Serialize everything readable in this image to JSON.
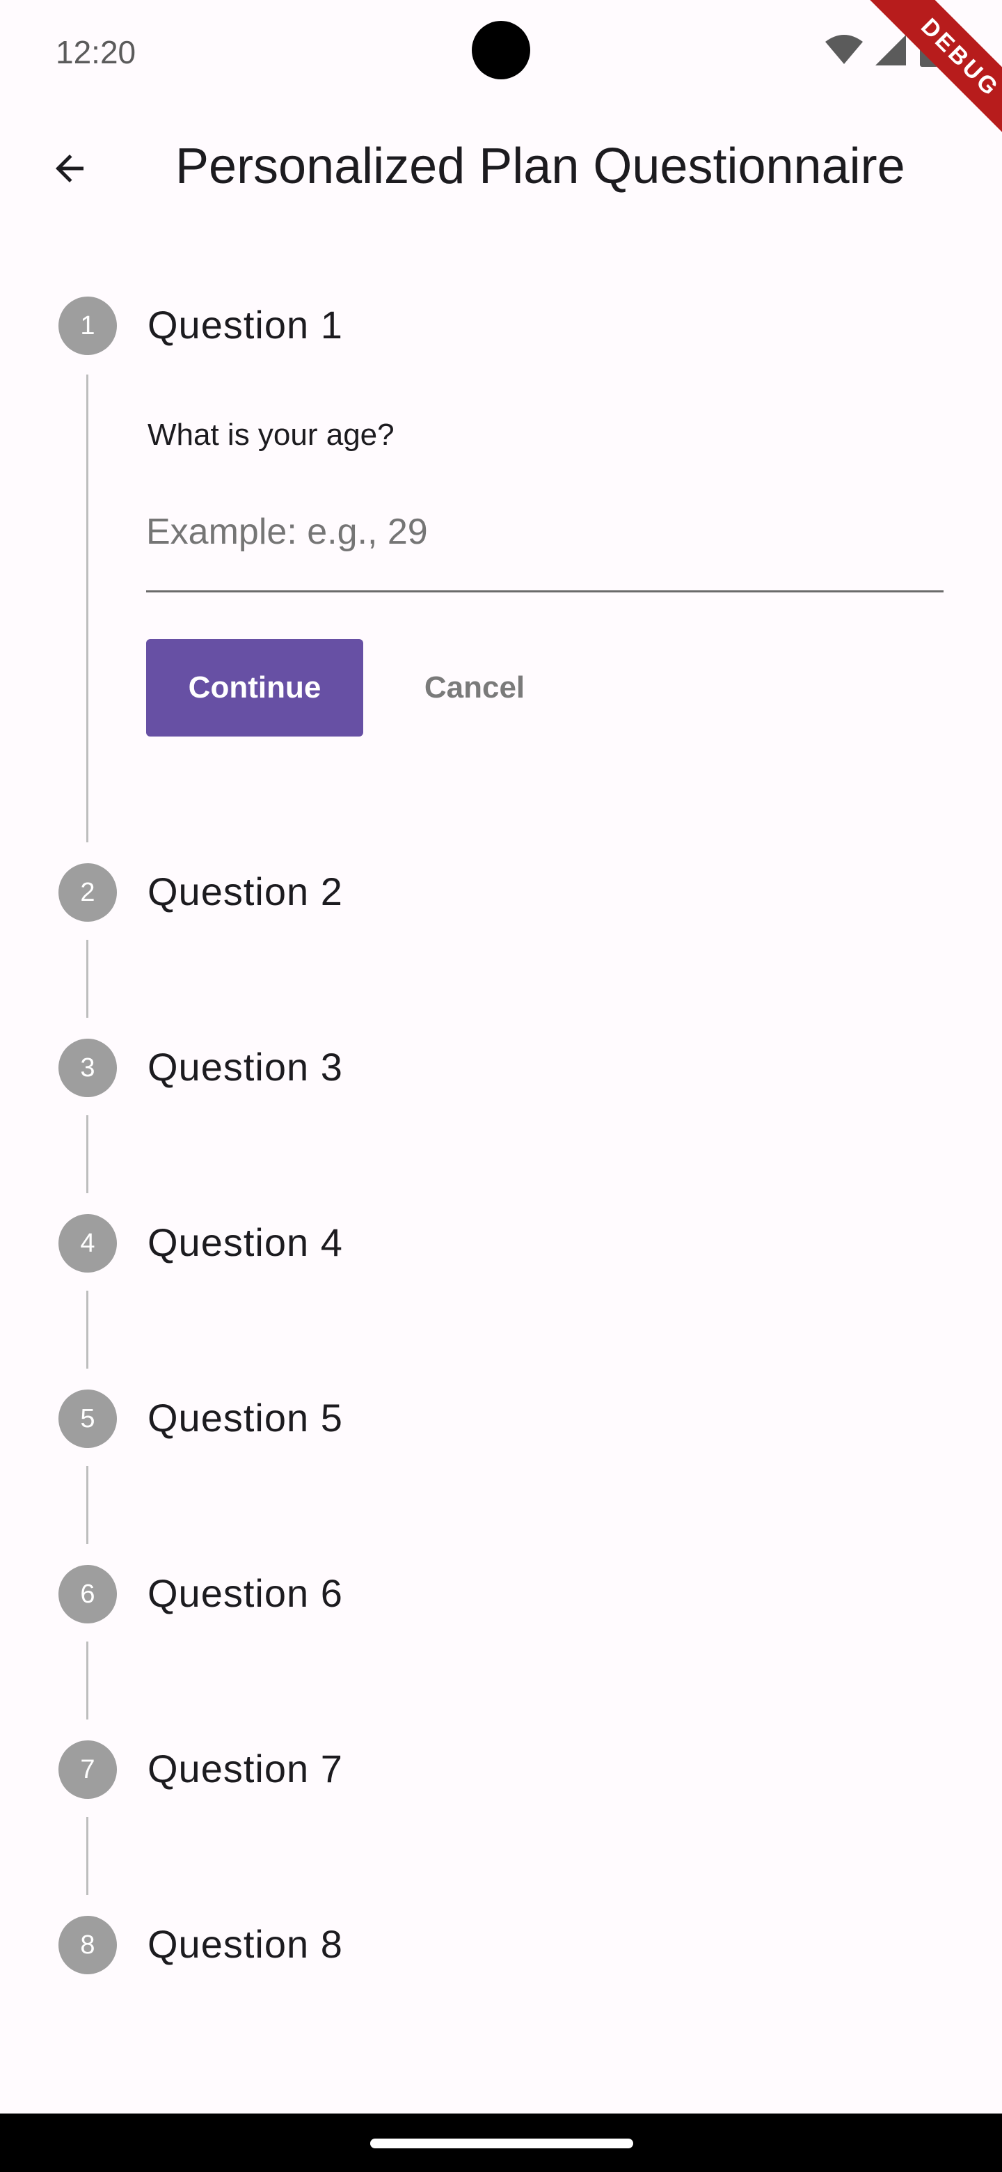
{
  "status_bar": {
    "time": "12:20",
    "debug_label": "DEBUG",
    "icons": [
      "wifi-icon",
      "signal-icon",
      "battery-icon"
    ]
  },
  "app_bar": {
    "back_icon": "arrow-left-icon",
    "title": "Personalized Plan Questionnaire"
  },
  "stepper": {
    "active_step": {
      "question": "What is your age?",
      "input_placeholder": "Example: e.g., 29",
      "input_value": "",
      "continue_label": "Continue",
      "cancel_label": "Cancel"
    },
    "steps": [
      {
        "number": "1",
        "title": "Question 1"
      },
      {
        "number": "2",
        "title": "Question 2"
      },
      {
        "number": "3",
        "title": "Question 3"
      },
      {
        "number": "4",
        "title": "Question 4"
      },
      {
        "number": "5",
        "title": "Question 5"
      },
      {
        "number": "6",
        "title": "Question 6"
      },
      {
        "number": "7",
        "title": "Question 7"
      },
      {
        "number": "8",
        "title": "Question 8"
      }
    ]
  },
  "colors": {
    "primary": "#6750a4",
    "step_inactive": "#9e9e9e",
    "background": "#fffbfe",
    "debug_banner": "#b71c1c"
  }
}
